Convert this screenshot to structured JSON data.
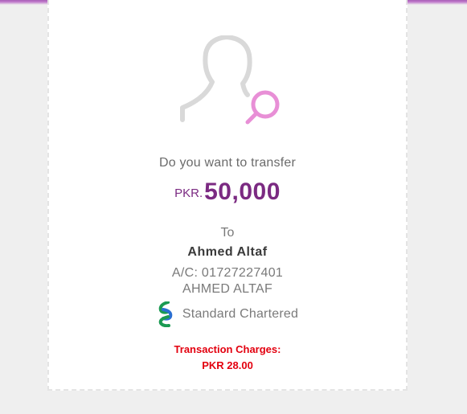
{
  "confirmation": {
    "question": "Do you want to transfer",
    "currency": "PKR.",
    "amount": "50,000",
    "to_label": "To",
    "recipient_name": "Ahmed Altaf",
    "account_number": "A/C: 01727227401",
    "account_title": "AHMED ALTAF",
    "bank_name": "Standard Chartered",
    "bank_logo_icon": "standard-chartered-logo-icon",
    "avatar_icon": "user-search-icon",
    "charges_label": "Transaction Charges:",
    "charges_value": "PKR 28.00"
  },
  "colors": {
    "accent": "#7b2a82",
    "header_bar": "#a960b7",
    "magnifier": "#e88fd6",
    "charges": "#e3000f",
    "bank_logo_green": "#1a9a52",
    "bank_logo_blue": "#2a6fd1"
  }
}
